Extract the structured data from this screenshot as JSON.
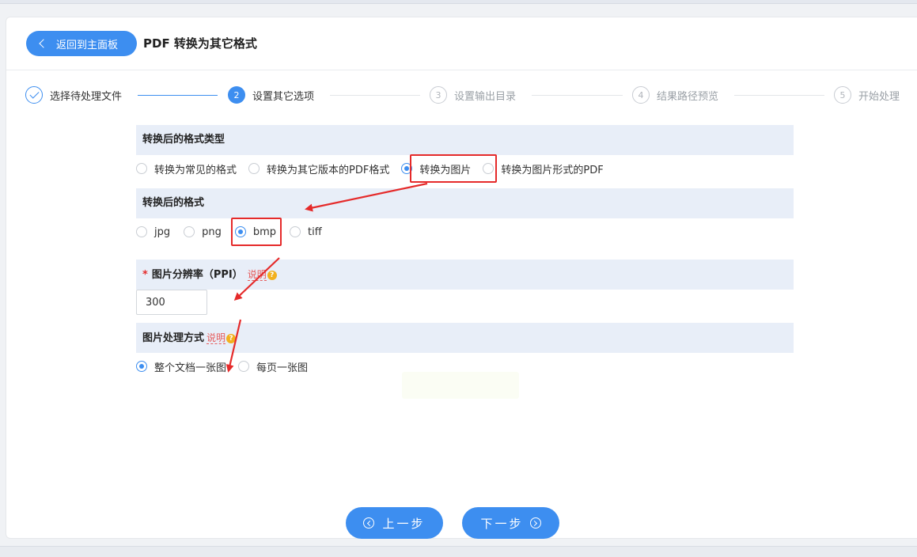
{
  "header": {
    "back_label": "返回到主面板",
    "title": "PDF 转换为其它格式"
  },
  "steps": [
    {
      "num": "1",
      "label": "选择待处理文件",
      "state": "done"
    },
    {
      "num": "2",
      "label": "设置其它选项",
      "state": "active"
    },
    {
      "num": "3",
      "label": "设置输出目录",
      "state": "todo"
    },
    {
      "num": "4",
      "label": "结果路径预览",
      "state": "todo"
    },
    {
      "num": "5",
      "label": "开始处理",
      "state": "todo"
    }
  ],
  "format_type": {
    "heading": "转换后的格式类型",
    "options": [
      "转换为常见的格式",
      "转换为其它版本的PDF格式",
      "转换为图片",
      "转换为图片形式的PDF"
    ],
    "selected": "转换为图片"
  },
  "format": {
    "heading": "转换后的格式",
    "options": [
      "jpg",
      "png",
      "bmp",
      "tiff"
    ],
    "selected": "bmp"
  },
  "resolution": {
    "required_mark": "*",
    "heading": "图片分辨率（PPI）",
    "explain": "说明",
    "value": "300"
  },
  "image_mode": {
    "heading": "图片处理方式",
    "explain": "说明",
    "options": [
      "整个文档一张图",
      "每页一张图"
    ],
    "selected": "整个文档一张图"
  },
  "footer": {
    "prev_label": "上一步",
    "next_label": "下一步"
  },
  "colors": {
    "accent": "#3d8ef0",
    "highlight": "#e52a2a",
    "section_bg": "#e8eef8"
  },
  "icons": [
    "chevron-left-icon",
    "check-icon",
    "question-icon",
    "arrow-left-circle-icon",
    "arrow-right-circle-icon"
  ]
}
